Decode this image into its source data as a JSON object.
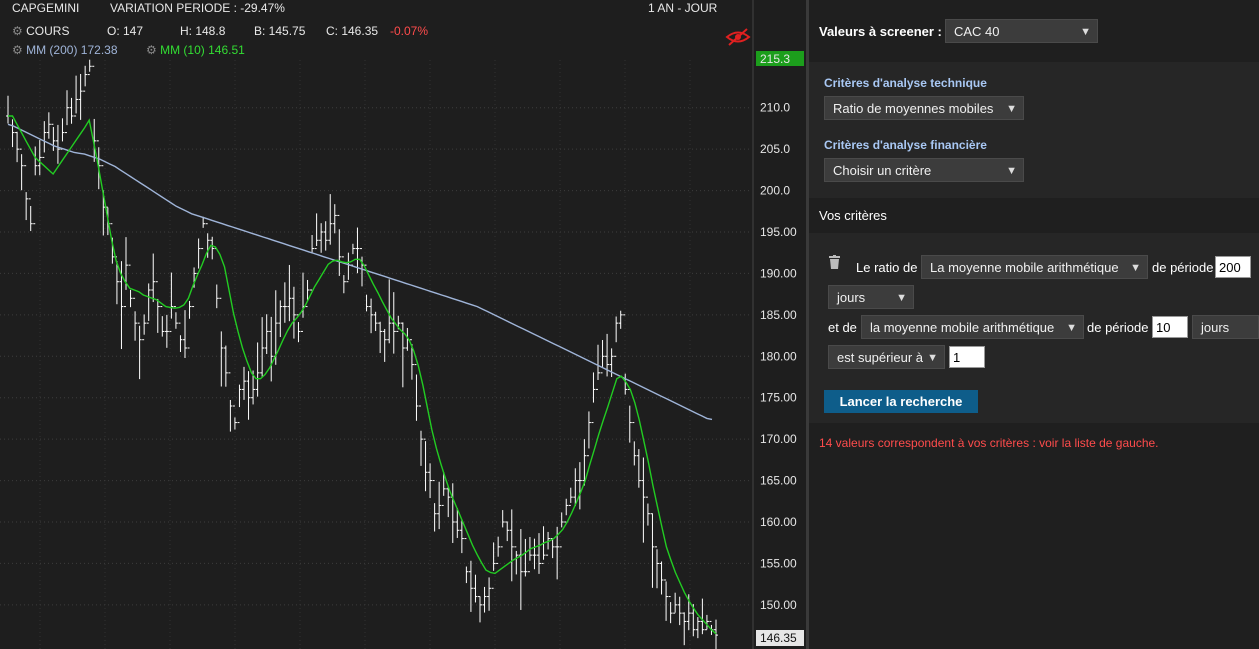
{
  "chart_header": {
    "symbol": "CAPGEMINI",
    "variation": "VARIATION PERIODE : -29.47%",
    "period": "1 AN - JOUR",
    "cours_label": "COURS",
    "open": "O: 147",
    "high": "H: 148.8",
    "low": "B: 145.75",
    "close": "C: 146.35",
    "change": "-0.07%",
    "mm200": "MM (200)",
    "mm200_value": "172.38",
    "mm10": "MM (10)",
    "mm10_value": "146.51",
    "hide_icon": "eye-slash-icon",
    "settings_icon": "gear-icon"
  },
  "chart_data": {
    "type": "line",
    "title": "",
    "xlabel": "",
    "ylabel": "",
    "ylim": [
      146,
      216
    ],
    "y_ticks": [
      "210.0",
      "205.0",
      "200.0",
      "195.00",
      "190.00",
      "185.00",
      "180.00",
      "175.00",
      "170.00",
      "165.00",
      "160.00",
      "155.00",
      "150.00"
    ],
    "top_marker": "215.3",
    "last_marker": "146.35",
    "grid": true,
    "colors": {
      "price": "#ffffff",
      "mm200": "#9fb4d8",
      "mm10": "#22cc22",
      "top_marker": "#1c9e1c"
    },
    "price": [
      209,
      207,
      205,
      203,
      199,
      196,
      203,
      204,
      207,
      208,
      206,
      205,
      207,
      210,
      209,
      211,
      212,
      214,
      215,
      206,
      203,
      198,
      196,
      192,
      189,
      186,
      191,
      187,
      184,
      182,
      184,
      188,
      189,
      186,
      183,
      183,
      186,
      184,
      182,
      181,
      186,
      190,
      193,
      196,
      194,
      193,
      187,
      181,
      178,
      174,
      172,
      176,
      177,
      175,
      176,
      178,
      181,
      183,
      180,
      184,
      186,
      186,
      187,
      185,
      183,
      186,
      188,
      193,
      194,
      195,
      194,
      196,
      197,
      192,
      189,
      191,
      193,
      193,
      191,
      186,
      185,
      184,
      183,
      182,
      184,
      183,
      184,
      181,
      182,
      179,
      174,
      170,
      166,
      165,
      161,
      162,
      164,
      163,
      160,
      159,
      158,
      154,
      152,
      151,
      150,
      151,
      152,
      155,
      157,
      160,
      159,
      157,
      156,
      154,
      154,
      156,
      156,
      155,
      156,
      158,
      157,
      157,
      160,
      162,
      163,
      165,
      165,
      168,
      172,
      176,
      178,
      180,
      179,
      180,
      184,
      185,
      176,
      172,
      168,
      165,
      163,
      161,
      157,
      155,
      153,
      151,
      149,
      150,
      149,
      148,
      149,
      147,
      148,
      147,
      148,
      147,
      146.35
    ],
    "mm10": [
      209,
      209,
      208,
      207,
      206,
      205,
      204,
      203.5,
      203,
      202.5,
      202,
      202.8,
      203.6,
      204.4,
      205.2,
      206,
      206.8,
      207.6,
      208.5,
      205.8,
      203,
      200,
      197,
      194,
      191.5,
      190,
      189,
      188.2,
      188,
      187.8,
      187.4,
      187.2,
      187,
      186.8,
      186.4,
      186,
      185.9,
      185.8,
      185.9,
      186.2,
      187,
      188.5,
      189.8,
      191,
      192.4,
      193.4,
      193.2,
      192.3,
      190.8,
      188,
      185.2,
      183,
      181,
      179.4,
      178,
      177.3,
      177.3,
      177.8,
      178.6,
      179.7,
      180.8,
      182,
      183.1,
      184,
      184.6,
      185.3,
      186.2,
      187.3,
      188.4,
      189.3,
      190.2,
      191.1,
      191.5,
      191.6,
      191.4,
      191.3,
      191.4,
      191.7,
      191.7,
      190.9,
      189.8,
      188.7,
      187.7,
      186.6,
      185.6,
      184.6,
      183.9,
      183.2,
      182.7,
      181.9,
      180.6,
      178.8,
      176.5,
      173.8,
      171.1,
      168.9,
      167,
      165.3,
      163.7,
      162.4,
      161.1,
      159.8,
      158.5,
      157.2,
      156.1,
      155.1,
      154.2,
      153.9,
      153.8,
      154.2,
      154.6,
      155,
      155.4,
      155.7,
      156,
      156.4,
      156.8,
      157,
      157.2,
      157.5,
      157.7,
      158,
      158.5,
      159.1,
      160,
      161.1,
      162.3,
      163.6,
      165,
      166.9,
      168.7,
      170.6,
      172.3,
      173.9,
      175.6,
      177.3,
      177.6,
      176.9,
      176,
      174.4,
      172.3,
      169.8,
      167.2,
      164.4,
      161.9,
      159.4,
      157,
      155.4,
      153.9,
      152.7,
      151.5,
      150.5,
      149.6,
      148.8,
      148.2,
      147.6,
      147,
      146.51
    ],
    "mm200": [
      208,
      207.8,
      207.5,
      207.2,
      206.9,
      206.6,
      206.3,
      206,
      205.7,
      205.4,
      205.2,
      205,
      204.8,
      204.6,
      204.5,
      204.4,
      204.2,
      204,
      203.8,
      203.5,
      203.2,
      202.9,
      202.5,
      202.1,
      201.7,
      201.3,
      200.9,
      200.5,
      200.1,
      199.7,
      199.3,
      198.9,
      198.5,
      198.1,
      197.8,
      197.5,
      197.2,
      197,
      196.8,
      196.6,
      196.4,
      196.2,
      196,
      195.8,
      195.6,
      195.4,
      195.2,
      195,
      194.8,
      194.6,
      194.4,
      194.2,
      194,
      193.8,
      193.6,
      193.4,
      193.2,
      193,
      192.8,
      192.6,
      192.4,
      192.2,
      192,
      191.8,
      191.6,
      191.4,
      191.2,
      191,
      190.8,
      190.6,
      190.4,
      190.2,
      190,
      189.8,
      189.6,
      189.4,
      189.2,
      189,
      188.8,
      188.6,
      188.4,
      188.2,
      188,
      187.8,
      187.6,
      187.4,
      187.2,
      187,
      186.8,
      186.6,
      186.4,
      186.2,
      186,
      185.7,
      185.4,
      185.1,
      184.8,
      184.5,
      184.2,
      183.9,
      183.6,
      183.3,
      183,
      182.7,
      182.4,
      182.1,
      181.8,
      181.5,
      181.2,
      180.9,
      180.6,
      180.3,
      180,
      179.7,
      179.4,
      179.1,
      178.8,
      178.5,
      178.2,
      177.9,
      177.6,
      177.3,
      177,
      176.7,
      176.4,
      176.1,
      175.8,
      175.5,
      175.2,
      174.9,
      174.6,
      174.3,
      174,
      173.7,
      173.4,
      173.1,
      172.8,
      172.5,
      172.38
    ]
  },
  "screener": {
    "values_label": "Valeurs à screener :",
    "values_select": "CAC 40",
    "tech_title": "Critères d'analyse technique",
    "tech_select": "Ratio de moyennes mobiles",
    "fin_title": "Critères d'analyse financière",
    "fin_select": "Choisir un critère",
    "vos_criteres": "Vos critères",
    "delete_icon": "trash-icon",
    "ratio_prefix": "Le ratio de",
    "ma1_select": "La moyenne mobile arithmétique",
    "periode_label_1": "de période",
    "periode_1": "200",
    "unit_1": "jours",
    "et_de": "et de",
    "ma2_select": "la moyenne mobile arithmétique",
    "periode_label_2": "de période",
    "periode_2": "10",
    "unit_2": "jours",
    "comparator": "est supérieur à",
    "threshold": "1",
    "run_button": "Lancer la recherche",
    "result": "14 valeurs correspondent à vos critères : voir la liste de gauche."
  }
}
